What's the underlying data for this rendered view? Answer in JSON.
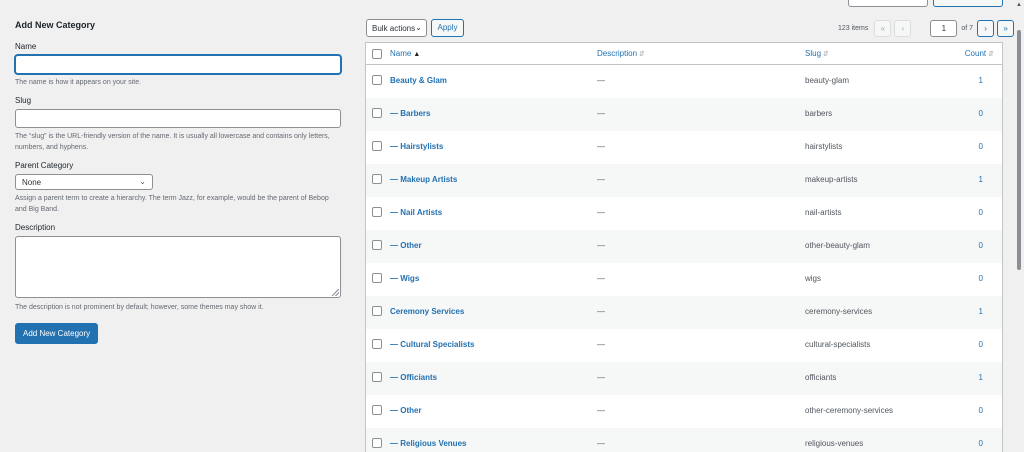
{
  "form": {
    "title": "Add New Category",
    "name_label": "Name",
    "name_help": "The name is how it appears on your site.",
    "slug_label": "Slug",
    "slug_help": "The “slug” is the URL-friendly version of the name. It is usually all lowercase and contains only letters, numbers, and hyphens.",
    "parent_label": "Parent Category",
    "parent_value": "None",
    "parent_help": "Assign a parent term to create a hierarchy. The term Jazz, for example, would be the parent of Bebop and Big Band.",
    "description_label": "Description",
    "description_help": "The description is not prominent by default; however, some themes may show it.",
    "submit_label": "Add New Category"
  },
  "toolbar": {
    "bulk_actions": "Bulk actions",
    "apply": "Apply",
    "items_count": "123 items",
    "first": "«",
    "prev": "‹",
    "current_page": "1",
    "of_pages": "of 7",
    "next": "›",
    "last": "»"
  },
  "table": {
    "columns": {
      "name": "Name",
      "description": "Description",
      "slug": "Slug",
      "count": "Count"
    },
    "rows": [
      {
        "name": "Beauty & Glam",
        "description": "—",
        "slug": "beauty-glam",
        "count": "1"
      },
      {
        "name": "— Barbers",
        "description": "—",
        "slug": "barbers",
        "count": "0"
      },
      {
        "name": "— Hairstylists",
        "description": "—",
        "slug": "hairstylists",
        "count": "0"
      },
      {
        "name": "— Makeup Artists",
        "description": "—",
        "slug": "makeup-artists",
        "count": "1"
      },
      {
        "name": "— Nail Artists",
        "description": "—",
        "slug": "nail-artists",
        "count": "0"
      },
      {
        "name": "— Other",
        "description": "—",
        "slug": "other-beauty-glam",
        "count": "0"
      },
      {
        "name": "— Wigs",
        "description": "—",
        "slug": "wigs",
        "count": "0"
      },
      {
        "name": "Ceremony Services",
        "description": "—",
        "slug": "ceremony-services",
        "count": "1"
      },
      {
        "name": "— Cultural Specialists",
        "description": "—",
        "slug": "cultural-specialists",
        "count": "0"
      },
      {
        "name": "— Officiants",
        "description": "—",
        "slug": "officiants",
        "count": "1"
      },
      {
        "name": "— Other",
        "description": "—",
        "slug": "other-ceremony-services",
        "count": "0"
      },
      {
        "name": "— Religious Venues",
        "description": "—",
        "slug": "religious-venues",
        "count": "0"
      }
    ]
  },
  "colors": {
    "link": "#2271b1",
    "primary_button": "#2271b1",
    "background": "#f0f0f1"
  }
}
